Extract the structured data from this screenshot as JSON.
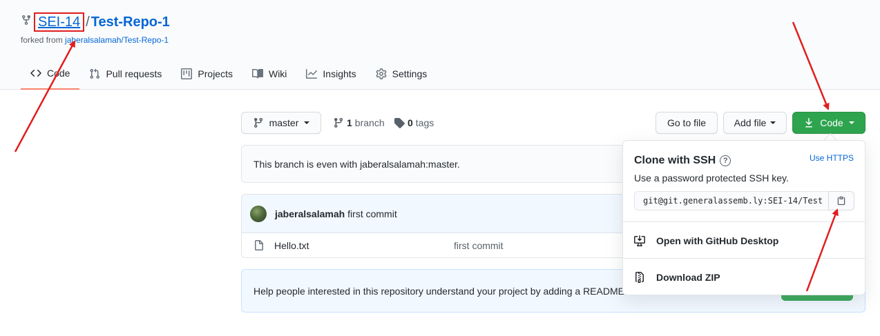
{
  "repo": {
    "owner": "SEI-14",
    "separator": "/",
    "name": "Test-Repo-1",
    "forked_prefix": "forked from",
    "forked_source": "jaberalsalamah/Test-Repo-1"
  },
  "tabs": [
    {
      "label": "Code",
      "icon": "code-icon",
      "active": true
    },
    {
      "label": "Pull requests",
      "icon": "pull-request-icon"
    },
    {
      "label": "Projects",
      "icon": "project-icon"
    },
    {
      "label": "Wiki",
      "icon": "book-icon"
    },
    {
      "label": "Insights",
      "icon": "graph-icon"
    },
    {
      "label": "Settings",
      "icon": "gear-icon"
    }
  ],
  "toolbar": {
    "branch_label": "master",
    "branch_count": "1",
    "branch_word": "branch",
    "tag_count": "0",
    "tag_word": "tags",
    "go_to_file": "Go to file",
    "add_file": "Add file",
    "code_label": "Code"
  },
  "status_message": "This branch is even with jaberalsalamah:master.",
  "commit": {
    "author": "jaberalsalamah",
    "message": "first commit"
  },
  "files": [
    {
      "name": "Hello.txt",
      "message": "first commit"
    }
  ],
  "readme_prompt": "Help people interested in this repository understand your project by adding a README.",
  "clone": {
    "title": "Clone with SSH",
    "use_https": "Use HTTPS",
    "description": "Use a password protected SSH key.",
    "url": "git@git.generalassemb.ly:SEI-14/Test",
    "open_desktop": "Open with GitHub Desktop",
    "download_zip": "Download ZIP"
  },
  "colors": {
    "primary_green": "#2ea44f",
    "link_blue": "#0366d6",
    "annotation_red": "#e01e1e",
    "active_tab_underline": "#f9826c"
  }
}
